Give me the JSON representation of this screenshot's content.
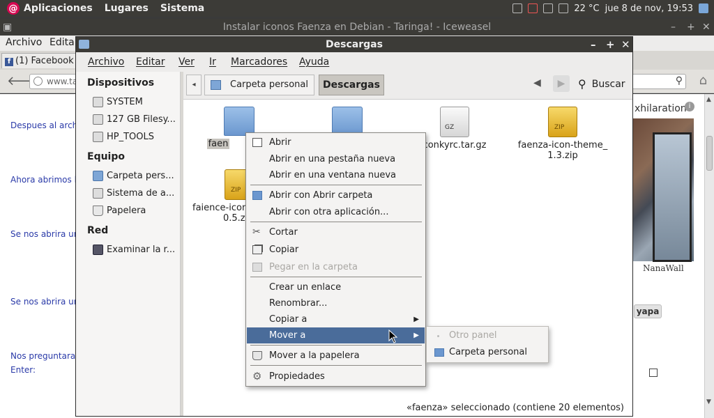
{
  "top_panel": {
    "menus": [
      "Aplicaciones",
      "Lugares",
      "Sistema"
    ],
    "temperature": "22 °C",
    "datetime": "jue  8 de nov, 19:53"
  },
  "browser": {
    "title": "Instalar iconos Faenza en Debian - Taringa! - Iceweasel",
    "menu": [
      "Archivo",
      "Editar"
    ],
    "tab": "(1) Facebook",
    "url": "www.ta",
    "page_lines": [
      "Despues al arch",
      "Ahora abrimos l",
      "Se nos abrira ur",
      "Se nos abrira ur",
      "Nos preguntara",
      "Enter:"
    ],
    "ad": {
      "title": "xhilaration",
      "brand": "NanaWall",
      "button": "yapa"
    }
  },
  "nautilus": {
    "title": "Descargas",
    "menu": [
      "Archivo",
      "Editar",
      "Ver",
      "Ir",
      "Marcadores",
      "Ayuda"
    ],
    "sidebar": {
      "dispositivos_header": "Dispositivos",
      "dispositivos": [
        "SYSTEM",
        "127 GB Filesy...",
        "HP_TOOLS"
      ],
      "equipo_header": "Equipo",
      "equipo": [
        "Carpeta pers...",
        "Sistema de a...",
        "Papelera"
      ],
      "red_header": "Red",
      "red": [
        "Examinar la r..."
      ]
    },
    "path": {
      "home": "Carpeta personal",
      "current": "Descargas"
    },
    "search_label": "Buscar",
    "files": [
      {
        "name": "faenza",
        "type": "folder",
        "visible_label": "faen"
      },
      {
        "name": "",
        "type": "folder",
        "visible_label": ""
      },
      {
        "name": "conkyrc.tar.gz",
        "type": "gz",
        "visible_label": "conkyrc.tar.gz"
      },
      {
        "name": "faenza-icon-theme_1.3.zip",
        "type": "zip",
        "visible_label_line1": "faenza-icon-theme_",
        "visible_label_line2": "1.3.zip"
      },
      {
        "name": "faience-icon",
        "type": "zip",
        "visible_label_line1": "faience-icon",
        "visible_label_line2": "0.5.z"
      }
    ],
    "gz_badge": "GZ",
    "zip_badge": "ZIP",
    "status": "«faenza» seleccionado (contiene 20 elementos)"
  },
  "context_menu": {
    "open": "Abrir",
    "open_tab": "Abrir en una pestaña nueva",
    "open_window": "Abrir en una ventana nueva",
    "open_with_folder": "Abrir con Abrir carpeta",
    "open_with_other": "Abrir con otra aplicación...",
    "cut": "Cortar",
    "copy": "Copiar",
    "paste": "Pegar en la carpeta",
    "make_link": "Crear un enlace",
    "rename": "Renombrar...",
    "copy_to": "Copiar a",
    "move_to": "Mover a",
    "move_to_trash": "Mover a la papelera",
    "properties": "Propiedades"
  },
  "submenu": {
    "other_panel": "Otro panel",
    "home_folder": "Carpeta personal"
  }
}
